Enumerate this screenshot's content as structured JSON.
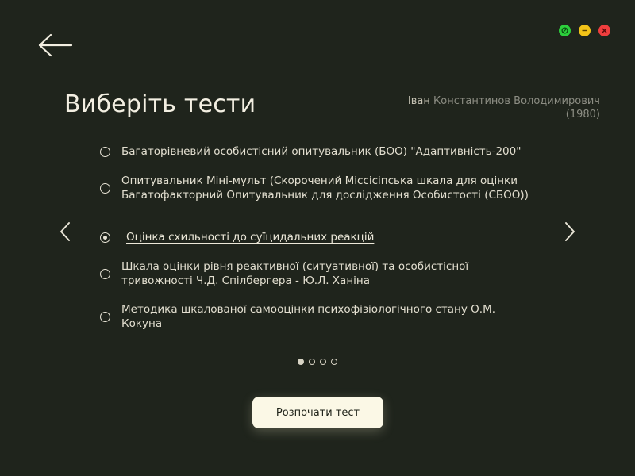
{
  "header": {
    "back_icon": "arrow-left-icon",
    "title": "Виберіть тести"
  },
  "window_controls": [
    {
      "name": "maximize",
      "color": "#2ccf3c"
    },
    {
      "name": "minimize",
      "color": "#f2c318"
    },
    {
      "name": "close",
      "color": "#ef3e3e"
    }
  ],
  "user": {
    "first_name": "Іван",
    "rest_name": "Константинов Володимирович",
    "birth_year": "(1980)"
  },
  "tests": [
    {
      "label": "Багаторівневий особистісний опитувальник (БОО) \"Адаптивність-200\"",
      "selected": false
    },
    {
      "label": "Опитувальник Міні-мульт (Скорочений Міссісіпська шкала для оцінки Багатофакторний Опитувальник для дослідження Особистості (СБОО))",
      "selected": false
    },
    {
      "label": "Оцінка схильності до суїцидальних реакцій",
      "selected": true
    },
    {
      "label": "Шкала оцінки рівня реактивної (ситуативної) та особистісної тривожності Ч.Д. Спілбергера - Ю.Л. Ханіна",
      "selected": false
    },
    {
      "label": "Методика шкалованої самооцінки психофізіологічного стану О.М. Кокуна",
      "selected": false
    }
  ],
  "pager": {
    "pages": 4,
    "current": 1
  },
  "start_button": {
    "label": "Розпочати тест"
  },
  "colors": {
    "background": "#1f241c",
    "text": "#efeadb",
    "button_bg": "#fbf8e6"
  }
}
